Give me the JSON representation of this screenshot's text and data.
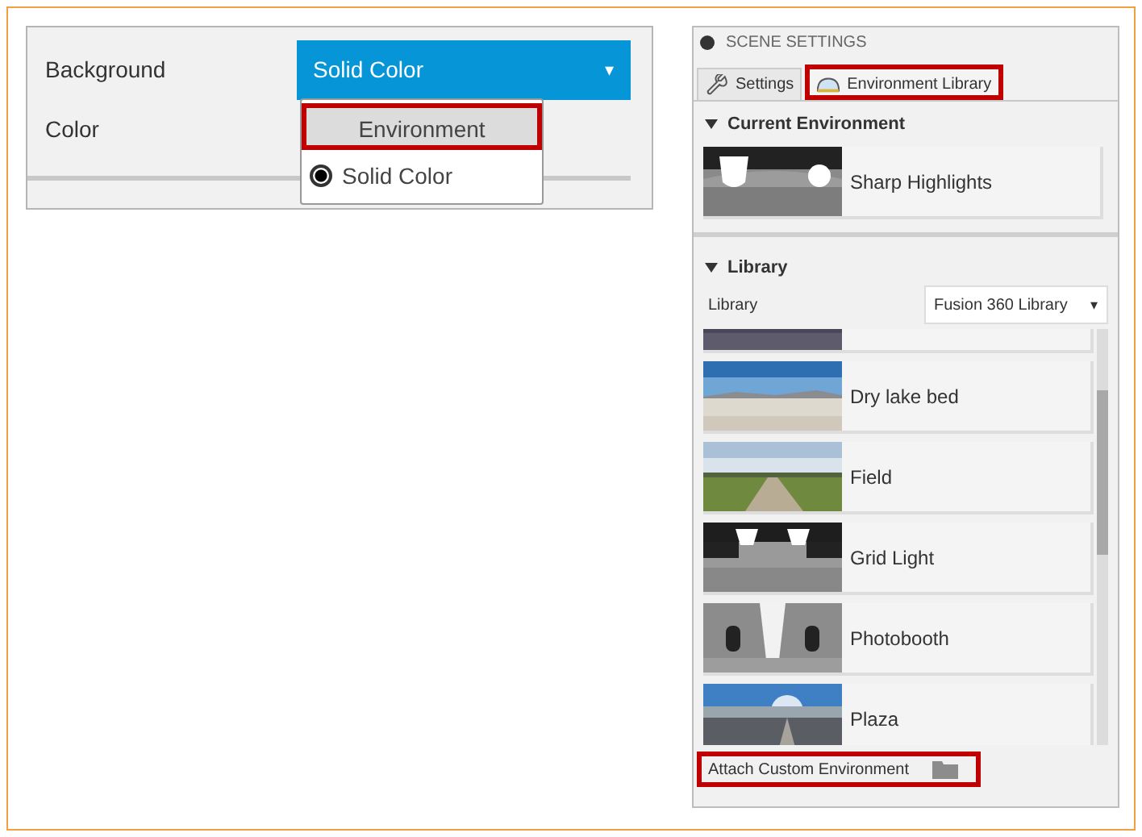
{
  "background_panel": {
    "label": "Background",
    "dropdown": {
      "value": "Solid Color",
      "caret": "▾"
    },
    "color_label": "Color",
    "menu": [
      {
        "kind": "plain",
        "label": "Environment",
        "selected": false,
        "highlighted": true
      },
      {
        "kind": "radio",
        "label": "Solid Color",
        "selected": true,
        "highlighted": false
      }
    ]
  },
  "scene_settings": {
    "title": "SCENE SETTINGS",
    "tabs": [
      {
        "label": "Settings",
        "selected": false,
        "highlighted": false
      },
      {
        "label": "Environment Library",
        "selected": true,
        "highlighted": true
      }
    ],
    "current_environment": {
      "heading": "Current Environment",
      "expanded": true,
      "item": {
        "name": "Sharp Highlights"
      }
    },
    "library": {
      "heading": "Library",
      "expanded": true,
      "field_label": "Library",
      "dropdown": {
        "value": "Fusion 360 Library",
        "caret": "▾"
      },
      "items": [
        {
          "kind": "partial"
        },
        {
          "kind": "full",
          "name": "Dry lake bed"
        },
        {
          "kind": "full",
          "name": "Field"
        },
        {
          "kind": "full",
          "name": "Grid Light"
        },
        {
          "kind": "full",
          "name": "Photobooth"
        },
        {
          "kind": "full",
          "name": "Plaza"
        }
      ]
    },
    "attach": {
      "label": "Attach Custom Environment",
      "highlighted": true
    }
  }
}
